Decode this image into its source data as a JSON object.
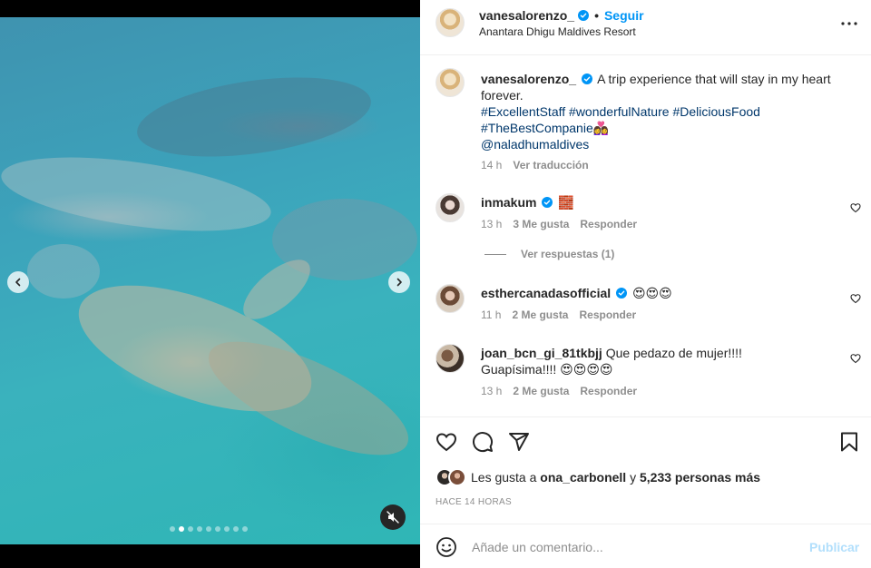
{
  "colors": {
    "accent": "#0095f6",
    "hashtag": "#00376b",
    "muted": "#8e8e8e",
    "text": "#262626",
    "publish_disabled": "#b2dffc"
  },
  "media": {
    "alt_description_icon": "mute-icon",
    "carousel": {
      "count": 9,
      "active_index": 1
    }
  },
  "header": {
    "username": "vanesalorenzo_",
    "separator": "•",
    "follow_label": "Seguir",
    "location": "Anantara Dhigu Maldives Resort"
  },
  "caption": {
    "username": "vanesalorenzo_",
    "text": "A trip experience that will stay in my heart forever.",
    "hashtags": [
      "#ExcellentStaff",
      "#wonderfulNature",
      "#DeliciousFood",
      "#TheBestCompanie👩‍❤️‍👩"
    ],
    "mention": "@naladhumaldives",
    "time": "14 h",
    "translate_label": "Ver traducción"
  },
  "comments": [
    {
      "username": "inmakum",
      "text": "🧱",
      "time": "13 h",
      "likes": "3 Me gusta",
      "reply_label": "Responder"
    },
    {
      "username": "esthercanadasofficial",
      "text": "😍😍😍",
      "time": "11 h",
      "likes": "2 Me gusta",
      "reply_label": "Responder"
    },
    {
      "username": "joan_bcn_gi_81tkbjj",
      "text": "Que pedazo de mujer!!!! Guapísima!!!! 😍😍😍😍",
      "time": "13 h",
      "likes": "2 Me gusta",
      "reply_label": "Responder"
    }
  ],
  "view_replies_label": "Ver respuestas (1)",
  "likes_line": {
    "prefix": "Les gusta a",
    "user": "ona_carbonell",
    "connector": "y",
    "others": "5,233 personas más"
  },
  "time_ago": "HACE 14 HORAS",
  "add_comment": {
    "placeholder": "Añade un comentario...",
    "publish_label": "Publicar"
  }
}
